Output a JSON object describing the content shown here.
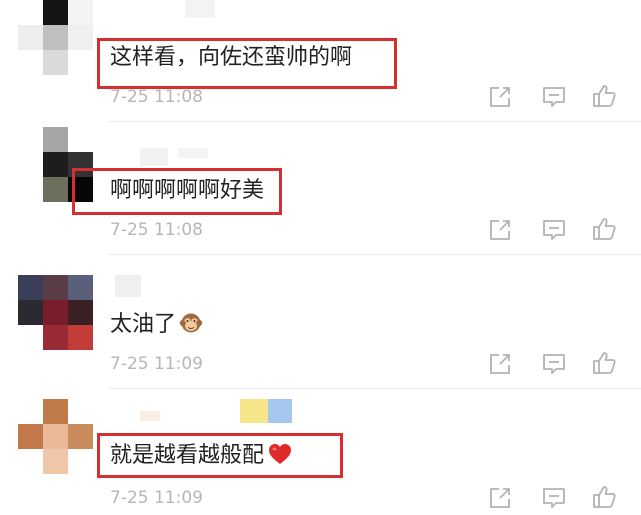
{
  "comments": [
    {
      "text": "这样看，向佐还蛮帅的啊",
      "time": "7-25 11:08",
      "highlighted": true
    },
    {
      "text": "啊啊啊啊啊好美",
      "time": "7-25 11:08",
      "highlighted": true
    },
    {
      "text": "太油了",
      "time": "7-25 11:09",
      "highlighted": false,
      "emoji": "see-no-evil-monkey-icon"
    },
    {
      "text": "就是越看越般配",
      "time": "7-25 11:09",
      "highlighted": true,
      "emoji": "red-heart-icon"
    }
  ],
  "colors": {
    "highlight_border": "#d62f2f",
    "text": "#222222",
    "timestamp": "#b6b6b6",
    "icon": "#b3b3b3",
    "divider": "#ececec"
  },
  "icons": [
    "share-icon",
    "comment-icon",
    "like-icon"
  ]
}
